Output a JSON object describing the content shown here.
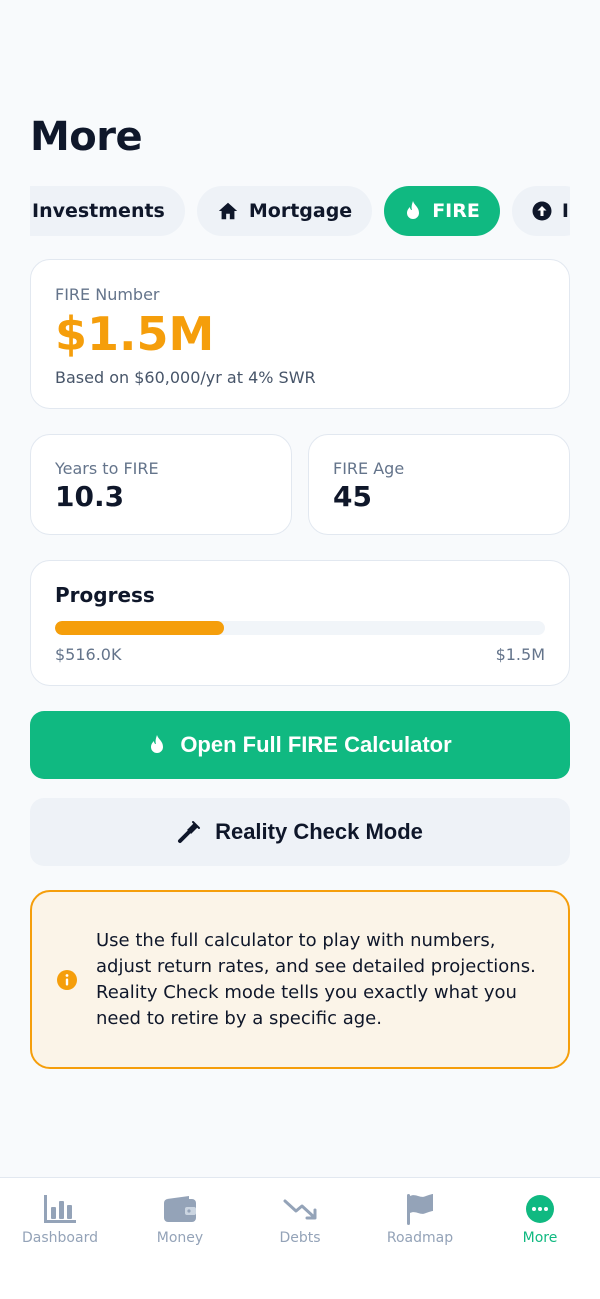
{
  "page": {
    "title": "More"
  },
  "tabs": [
    {
      "label": "Investments",
      "icon": "none",
      "active": false
    },
    {
      "label": "Mortgage",
      "icon": "home-icon",
      "active": false
    },
    {
      "label": "FIRE",
      "icon": "flame-icon",
      "active": true
    },
    {
      "label": "I",
      "icon": "arrow-up-circle-icon",
      "active": false
    }
  ],
  "fire_number": {
    "label": "FIRE Number",
    "value": "$1.5M",
    "subtitle": "Based on $60,000/yr at 4% SWR"
  },
  "stats": {
    "years": {
      "label": "Years to FIRE",
      "value": "10.3"
    },
    "age": {
      "label": "FIRE Age",
      "value": "45"
    }
  },
  "progress": {
    "title": "Progress",
    "current": "$516.0K",
    "target": "$1.5M",
    "percent": 34.4
  },
  "actions": {
    "primary_label": "Open Full FIRE Calculator",
    "secondary_label": "Reality Check Mode"
  },
  "info": {
    "text": "Use the full calculator to play with numbers, adjust return rates, and see detailed projections. Reality Check mode tells you exactly what you need to retire by a specific age."
  },
  "nav": [
    {
      "label": "Dashboard",
      "icon": "bar-chart-icon",
      "active": false
    },
    {
      "label": "Money",
      "icon": "wallet-icon",
      "active": false
    },
    {
      "label": "Debts",
      "icon": "trend-down-icon",
      "active": false
    },
    {
      "label": "Roadmap",
      "icon": "flag-icon",
      "active": false
    },
    {
      "label": "More",
      "icon": "more-dots-icon",
      "active": true
    }
  ],
  "colors": {
    "accent": "#10b981",
    "warning": "#f59e0b",
    "text": "#0f172a",
    "muted": "#64748b"
  }
}
